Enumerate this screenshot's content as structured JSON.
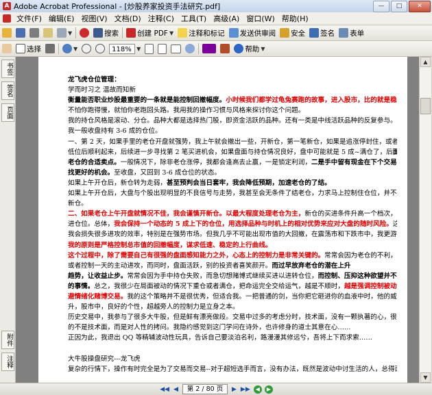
{
  "window": {
    "title": "Adobe Acrobat Professional - [炒股养家投资手法研究.pdf]",
    "minimize": "—",
    "maximize": "□",
    "close": "✕"
  },
  "menu": [
    "文件(F)",
    "编辑(E)",
    "视图(V)",
    "文档(D)",
    "注释(C)",
    "工具(T)",
    "高级(A)",
    "窗口(W)",
    "帮助(H)"
  ],
  "toolbar1": {
    "search": "搜索",
    "create_pdf": "创建 PDF",
    "comment": "注释和标记",
    "send_review": "发送供审阅",
    "security": "安全",
    "sign": "签名",
    "forms": "表单"
  },
  "toolbar2": {
    "select": "选择",
    "zoom_level": "118%",
    "help": "帮助"
  },
  "sidebar": {
    "tabs_top": [
      "书签",
      "签名",
      "页面"
    ],
    "tabs_bottom": [
      "附件",
      "注释"
    ]
  },
  "document": {
    "lines": [
      [
        {
          "t": "龙飞虎仓位管理：",
          "s": "b"
        }
      ],
      [
        {
          "t": "学而时习之 温故而知新",
          "s": ""
        }
      ],
      [
        {
          "t": "衡量能否职业炒股最重要的一条就是能控制回撤幅度。",
          "s": "b"
        },
        {
          "t": "小时候我们都学过龟兔赛跑的故事，进入股市，比的就是稳定性。",
          "s": "rb"
        }
      ],
      [
        {
          "t": "不怕你跑得慢，就怕你老跑回头路。我用我的操作习惯与风格来探讨你这个问题。",
          "s": ""
        }
      ],
      [
        {
          "t": "我的持仓风格是滚动、分仓。品种大都是选择热门股，即资金活跃的品种。还有一类是中线活跃品种的反复参与。",
          "s": ""
        }
      ],
      [
        {
          "t": "我一般收盘持有 3-6 成的仓位。",
          "s": ""
        }
      ],
      [
        {
          "t": "一、第 2 天，如果手里的老仓开盘就强势，我上午就会撤出一些，开新仓，第一笔新仓，如果是追涨停封住，或者低吸强势股",
          "s": ""
        }
      ],
      [
        {
          "t": "低位后顺利起来，后续进一步寻找第 2 笔买进机会，如果盘面与持仓情况良好，盘中可能就是 5 成~满仓了，后",
          "s": ""
        },
        {
          "t": "面就是寻找",
          "s": "b"
        }
      ],
      [
        {
          "t": "老仓的合适卖点。",
          "s": "b"
        },
        {
          "t": "一般情况下，除非老仓涨停，我都会逢高去止赢，一是锁定利润，",
          "s": ""
        },
        {
          "t": "二是手中留有现金在下个交易日可以寻",
          "s": "b"
        }
      ],
      [
        {
          "t": "找更好的机会。",
          "s": "b"
        },
        {
          "t": "至收盘，又回到 3-6 成仓位的状态。",
          "s": ""
        }
      ],
      [
        {
          "t": "如果上午开仓后，新仓转为走弱，",
          "s": ""
        },
        {
          "t": "甚至预判会当日套牢，我会降低预期，加速老仓的了结。",
          "s": "b"
        }
      ],
      [
        {
          "t": "如果上午开仓后，大盘与个股出现明显的不良信号与走势，我甚至会无条件了结老仓，力求马上控制住仓位，并不在轻易开",
          "s": ""
        }
      ],
      [
        {
          "t": "新仓。",
          "s": ""
        }
      ],
      [
        {
          "t": "二、如果老仓上午开盘就情况不佳，我会谨慎开新仓。以最大程度处理老仓为主，",
          "s": "rb"
        },
        {
          "t": "新仓的买进条件升高一个档次，且降低买",
          "s": ""
        }
      ],
      [
        {
          "t": "进仓位。总体，",
          "s": ""
        },
        {
          "t": "我会保持一个动态的 5 成上下的仓位，用选择品种与时机上的相对优势来应对大盘的随时风险。",
          "s": "rb"
        },
        {
          "t": "这样做，",
          "s": ""
        }
      ],
      [
        {
          "t": "我会损失很多进攻的效率，特别是在强势市场。但我几乎不可能出现市值的大回撤，在震荡市和下跌市中，我更游刃有余，",
          "s": ""
        }
      ],
      [
        {
          "t": "我的原则是严格控制总市值的回撤幅度，谋求低速、稳定的上行曲线。",
          "s": "rb"
        }
      ],
      [
        {
          "t": "这个过程中，除了需要自己有很强的盘面感知能力之外，心态上的控制力是非常关键的。",
          "s": "rb"
        },
        {
          "t": "常常会因为老仓的不利，而放弃",
          "s": ""
        }
      ],
      [
        {
          "t": "或者控制一天的主动进攻，而同时，盘面活跃，别的投资者喜笑颜开。",
          "s": ""
        },
        {
          "t": "而过早放弃老仓的潜在上升",
          "s": "b"
        }
      ],
      [
        {
          "t": "趋势，让收益止步。",
          "s": "b"
        },
        {
          "t": "常常会因为手中持仓失败，而急切想赌博式继续买进以进转仓位，",
          "s": ""
        },
        {
          "t": "而控制、压抑这种欲望并不是件快乐",
          "s": "b"
        }
      ],
      [
        {
          "t": "的事情。",
          "s": "b"
        },
        {
          "t": "总之，我很少在局面被动的情况下重仓或者满仓，把命运完全交给运气，越是不顺时，",
          "s": ""
        },
        {
          "t": "越是强调控制被动仓位，回",
          "s": "rb"
        }
      ],
      [
        {
          "t": "避情绪化赌博交易。",
          "s": "rb"
        },
        {
          "t": "我的这个策略并不是很优秀，但适合我。一把普通的剑，当你把它砸进你的血液中时，他的威力就然上",
          "s": ""
        }
      ],
      [
        {
          "t": "升，股市中，良好的个性，超越旁人的控制力是立身之本。",
          "s": ""
        }
      ],
      [
        {
          "t": "历史交易中，我参与了很多大牛股，但是鲜有漂亮做段。交易中过多的考虑分时，技术面，没有一颗执著的心，很多牛股靠",
          "s": ""
        }
      ],
      [
        {
          "t": "的不是技术面，而是对人性的拷问。我隐约感觉到这门学问在诗外，也许修身的道士其意在心……",
          "s": ""
        }
      ],
      [
        {
          "t": "正因为此，我退出 QQ 等精辅波动性玩具，告诉自己要淡泊名利，路漫漫其修远兮，吾将上下而求索……",
          "s": ""
        }
      ],
      [
        {
          "t": "",
          "s": ""
        }
      ],
      [
        {
          "t": "大牛股操盘研究---龙飞虎",
          "s": ""
        }
      ],
      [
        {
          "t": "复杂的行情下，操作有时完全是为了交易而交易--对于超短选手而言，没有办法，既然是波动中讨生活的人，总得面对。",
          "s": ""
        }
      ]
    ]
  },
  "statusbar": {
    "page_display": "第 2 / 80 页",
    "first": "◀◀",
    "prev": "◀",
    "next": "▶",
    "last": "▶▶",
    "back": "◀",
    "forward": "▶"
  },
  "colors": {
    "emphasis_red": "#e00000",
    "app_red": "#c62828",
    "nav_green": "#2e9c3a"
  }
}
